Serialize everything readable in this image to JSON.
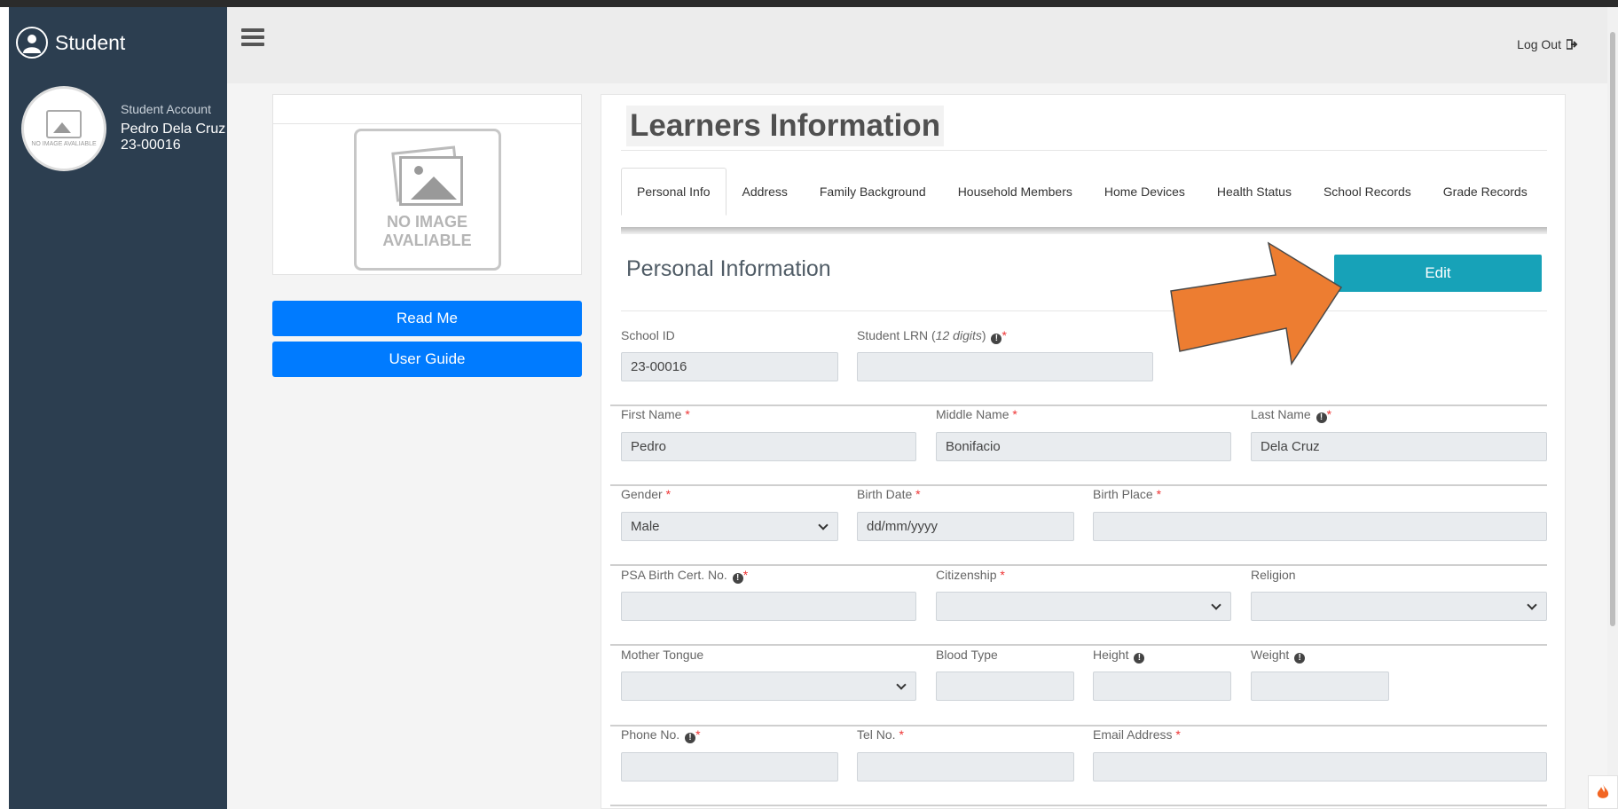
{
  "sidebar": {
    "brand": "Student",
    "role": "Student Account",
    "name": "Pedro Dela Cruz",
    "id": "23-00016",
    "avatar_caption": "NO IMAGE AVALIABLE"
  },
  "topbar": {
    "logout": "Log Out"
  },
  "left_panel": {
    "no_image_line1": "NO IMAGE",
    "no_image_line2": "AVALIABLE",
    "read_me": "Read Me",
    "user_guide": "User Guide"
  },
  "main": {
    "title": "Learners Information",
    "tabs": [
      {
        "label": "Personal Info"
      },
      {
        "label": "Address"
      },
      {
        "label": "Family Background"
      },
      {
        "label": "Household Members"
      },
      {
        "label": "Home Devices"
      },
      {
        "label": "Health Status"
      },
      {
        "label": "School Records"
      },
      {
        "label": "Grade Records"
      }
    ],
    "section_title": "Personal Information",
    "edit": "Edit"
  },
  "form": {
    "school_id": {
      "label": "School ID",
      "value": "23-00016"
    },
    "lrn": {
      "label": "Student LRN (",
      "hint": "12 digits",
      "label_end": ")",
      "value": ""
    },
    "first_name": {
      "label": "First Name",
      "value": "Pedro"
    },
    "middle_name": {
      "label": "Middle Name",
      "value": "Bonifacio"
    },
    "last_name": {
      "label": "Last Name",
      "value": "Dela Cruz"
    },
    "gender": {
      "label": "Gender",
      "value": "Male"
    },
    "birth_date": {
      "label": "Birth Date",
      "value": "dd/mm/yyyy"
    },
    "birth_place": {
      "label": "Birth Place",
      "value": ""
    },
    "psa": {
      "label": "PSA Birth Cert. No.",
      "value": ""
    },
    "citizenship": {
      "label": "Citizenship",
      "value": ""
    },
    "religion": {
      "label": "Religion",
      "value": ""
    },
    "mother_tongue": {
      "label": "Mother Tongue",
      "value": ""
    },
    "blood_type": {
      "label": "Blood Type",
      "value": ""
    },
    "height": {
      "label": "Height",
      "value": ""
    },
    "weight": {
      "label": "Weight",
      "value": ""
    },
    "phone": {
      "label": "Phone No.",
      "value": ""
    },
    "tel": {
      "label": "Tel No.",
      "value": ""
    },
    "email": {
      "label": "Email Address",
      "value": ""
    }
  },
  "colors": {
    "sidebar_bg": "#2c3e50",
    "primary": "#007bff",
    "edit": "#17a2b8",
    "arrow": "#ed7d31"
  }
}
